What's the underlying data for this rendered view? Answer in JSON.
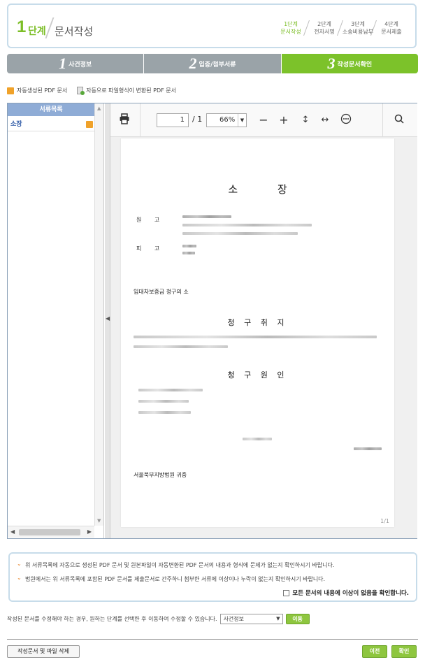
{
  "header": {
    "step_num": "1",
    "step_label": "단계",
    "title": "문서작성",
    "mini_steps": [
      {
        "step": "1단계",
        "label": "문서작성"
      },
      {
        "step": "2단계",
        "label": "전자서명"
      },
      {
        "step": "3단계",
        "label": "소송비용납부"
      },
      {
        "step": "4단계",
        "label": "문서제출"
      }
    ]
  },
  "tabs": [
    {
      "num": "1",
      "label": "사건정보"
    },
    {
      "num": "2",
      "label": "입증/첨부서류"
    },
    {
      "num": "3",
      "label": "작성문서확인"
    }
  ],
  "legend": {
    "auto_pdf": "자동생성된 PDF 문서",
    "converted_pdf": "자동으로 파일형식이 변환된 PDF 문서"
  },
  "sidebar": {
    "title": "서류목록",
    "items": [
      {
        "label": "소장"
      }
    ]
  },
  "viewer": {
    "page_current": "1",
    "page_total": "/ 1",
    "zoom": "66%",
    "page_footer": "1/1"
  },
  "document": {
    "title": "소 장",
    "plaintiff_label": "원 고",
    "defendant_label": "피 고",
    "case_name": "임대차보증금 청구의 소",
    "section_claim": "청 구 취 지",
    "section_cause": "청 구 원 인",
    "court": "서울북부지방법원 귀중"
  },
  "notices": {
    "line1": "위 서류목록에 자동으로 생성된 PDF 문서 및 원본파일이 자동변환된 PDF 문서의 내용과 형식에 문제가 없는지 확인하시기 바랍니다.",
    "line2": "법원에서는 위 서류목록에 포함된 PDF 문서를 제출문서로 간주하니 첨부한 서류에 이상이나 누락이 없는지 확인하시기 바랍니다.",
    "confirm": "모든 문서의 내용에 이상이 없음을 확인합니다."
  },
  "modify": {
    "text": "작성된 문서를 수정해야 하는 경우, 원하는 단계를 선택한 후 이동하여 수정할 수 있습니다.",
    "selected": "사건정보",
    "move_button": "이동"
  },
  "footer": {
    "delete_button": "작성문서 및 파일 삭제",
    "prev_button": "이전",
    "ok_button": "확인"
  }
}
